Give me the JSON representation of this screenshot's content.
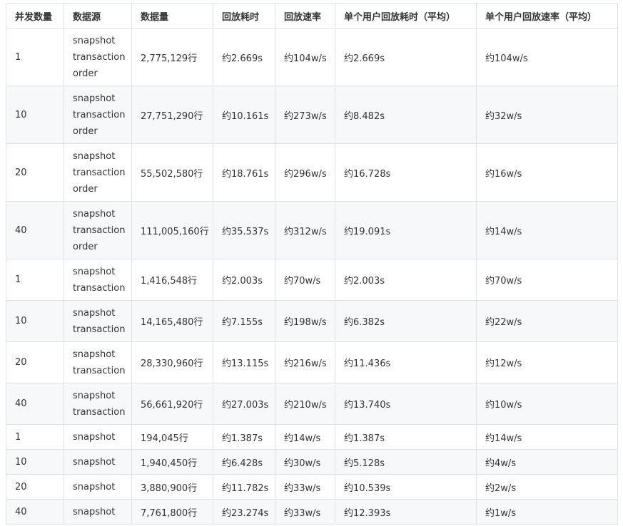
{
  "table": {
    "headers": [
      "并发数量",
      "数据源",
      "数据量",
      "回放耗时",
      "回放速率",
      "单个用户回放耗时（平均）",
      "单个用户回放速率（平均）"
    ],
    "rows": [
      {
        "concurrency": "1",
        "sources": [
          "snapshot",
          "transaction",
          "order"
        ],
        "rows_count": "2,775,129行",
        "replay_time": "约2.669s",
        "replay_rate": "约104w/s",
        "avg_user_time": "约2.669s",
        "avg_user_rate": "约104w/s"
      },
      {
        "concurrency": "10",
        "sources": [
          "snapshot",
          "transaction",
          "order"
        ],
        "rows_count": "27,751,290行",
        "replay_time": "约10.161s",
        "replay_rate": "约273w/s",
        "avg_user_time": "约8.482s",
        "avg_user_rate": "约32w/s"
      },
      {
        "concurrency": "20",
        "sources": [
          "snapshot",
          "transaction",
          "order"
        ],
        "rows_count": "55,502,580行",
        "replay_time": "约18.761s",
        "replay_rate": "约296w/s",
        "avg_user_time": "约16.728s",
        "avg_user_rate": "约16w/s"
      },
      {
        "concurrency": "40",
        "sources": [
          "snapshot",
          "transaction",
          "order"
        ],
        "rows_count": "111,005,160行",
        "replay_time": "约35.537s",
        "replay_rate": "约312w/s",
        "avg_user_time": "约19.091s",
        "avg_user_rate": "约14w/s"
      },
      {
        "concurrency": "1",
        "sources": [
          "snapshot",
          "transaction"
        ],
        "rows_count": "1,416,548行",
        "replay_time": "约2.003s",
        "replay_rate": "约70w/s",
        "avg_user_time": "约2.003s",
        "avg_user_rate": "约70w/s"
      },
      {
        "concurrency": "10",
        "sources": [
          "snapshot",
          "transaction"
        ],
        "rows_count": "14,165,480行",
        "replay_time": "约7.155s",
        "replay_rate": "约198w/s",
        "avg_user_time": "约6.382s",
        "avg_user_rate": "约22w/s"
      },
      {
        "concurrency": "20",
        "sources": [
          "snapshot",
          "transaction"
        ],
        "rows_count": "28,330,960行",
        "replay_time": "约13.115s",
        "replay_rate": "约216w/s",
        "avg_user_time": "约11.436s",
        "avg_user_rate": "约12w/s"
      },
      {
        "concurrency": "40",
        "sources": [
          "snapshot",
          "transaction"
        ],
        "rows_count": "56,661,920行",
        "replay_time": "约27.003s",
        "replay_rate": "约210w/s",
        "avg_user_time": "约13.740s",
        "avg_user_rate": "约10w/s"
      },
      {
        "concurrency": "1",
        "sources": [
          "snapshot"
        ],
        "rows_count": "194,045行",
        "replay_time": "约1.387s",
        "replay_rate": "约14w/s",
        "avg_user_time": "约1.387s",
        "avg_user_rate": "约14w/s"
      },
      {
        "concurrency": "10",
        "sources": [
          "snapshot"
        ],
        "rows_count": "1,940,450行",
        "replay_time": "约6.428s",
        "replay_rate": "约30w/s",
        "avg_user_time": "约5.128s",
        "avg_user_rate": "约4w/s"
      },
      {
        "concurrency": "20",
        "sources": [
          "snapshot"
        ],
        "rows_count": "3,880,900行",
        "replay_time": "约11.782s",
        "replay_rate": "约33w/s",
        "avg_user_time": "约10.539s",
        "avg_user_rate": "约2w/s"
      },
      {
        "concurrency": "40",
        "sources": [
          "snapshot"
        ],
        "rows_count": "7,761,800行",
        "replay_time": "约23.274s",
        "replay_rate": "约33w/s",
        "avg_user_time": "约12.393s",
        "avg_user_rate": "约1w/s"
      }
    ]
  },
  "colors": {
    "border": "#dfe2e5",
    "stripe": "#f6f8fa",
    "text": "#333333"
  }
}
